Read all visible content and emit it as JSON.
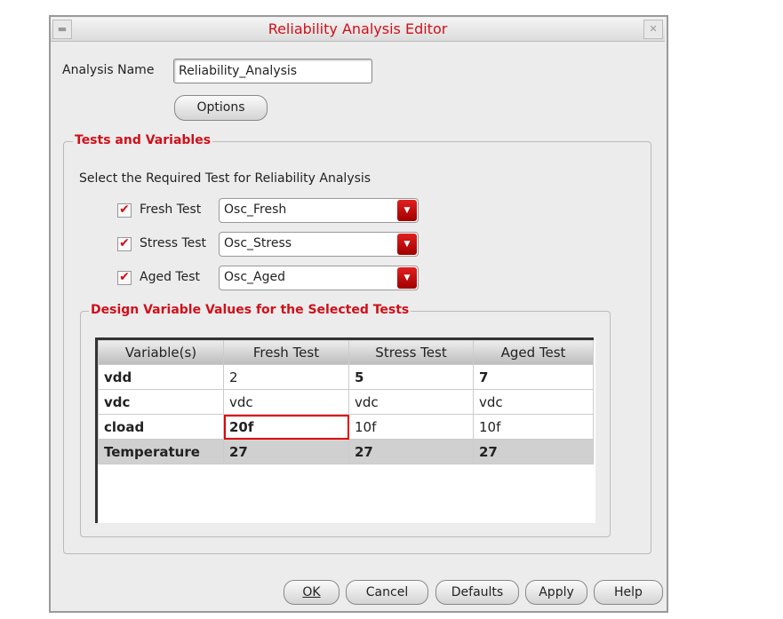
{
  "window": {
    "title": "Reliability Analysis Editor"
  },
  "analysis": {
    "label": "Analysis Name",
    "value": "Reliability_Analysis",
    "options_label": "Options"
  },
  "tests_group": {
    "title": "Tests and Variables",
    "instruction": "Select the Required Test for Reliability Analysis",
    "tests": [
      {
        "label": "Fresh Test",
        "checked": true,
        "value": "Osc_Fresh"
      },
      {
        "label": "Stress Test",
        "checked": true,
        "value": "Osc_Stress"
      },
      {
        "label": "Aged Test",
        "checked": true,
        "value": "Osc_Aged"
      }
    ]
  },
  "variables_group": {
    "title": "Design Variable Values for the Selected Tests",
    "columns": [
      "Variable(s)",
      "Fresh Test",
      "Stress Test",
      "Aged Test"
    ],
    "rows": [
      [
        "vdd",
        "2",
        "5",
        "7"
      ],
      [
        "vdc",
        "vdc",
        "vdc",
        "vdc"
      ],
      [
        "cload",
        "20f",
        "10f",
        "10f"
      ],
      [
        "Temperature",
        "27",
        "27",
        "27"
      ]
    ]
  },
  "buttons": {
    "ok": "OK",
    "cancel": "Cancel",
    "defaults": "Defaults",
    "apply": "Apply",
    "help": "Help"
  },
  "colors": {
    "accent": "#d0101a"
  }
}
